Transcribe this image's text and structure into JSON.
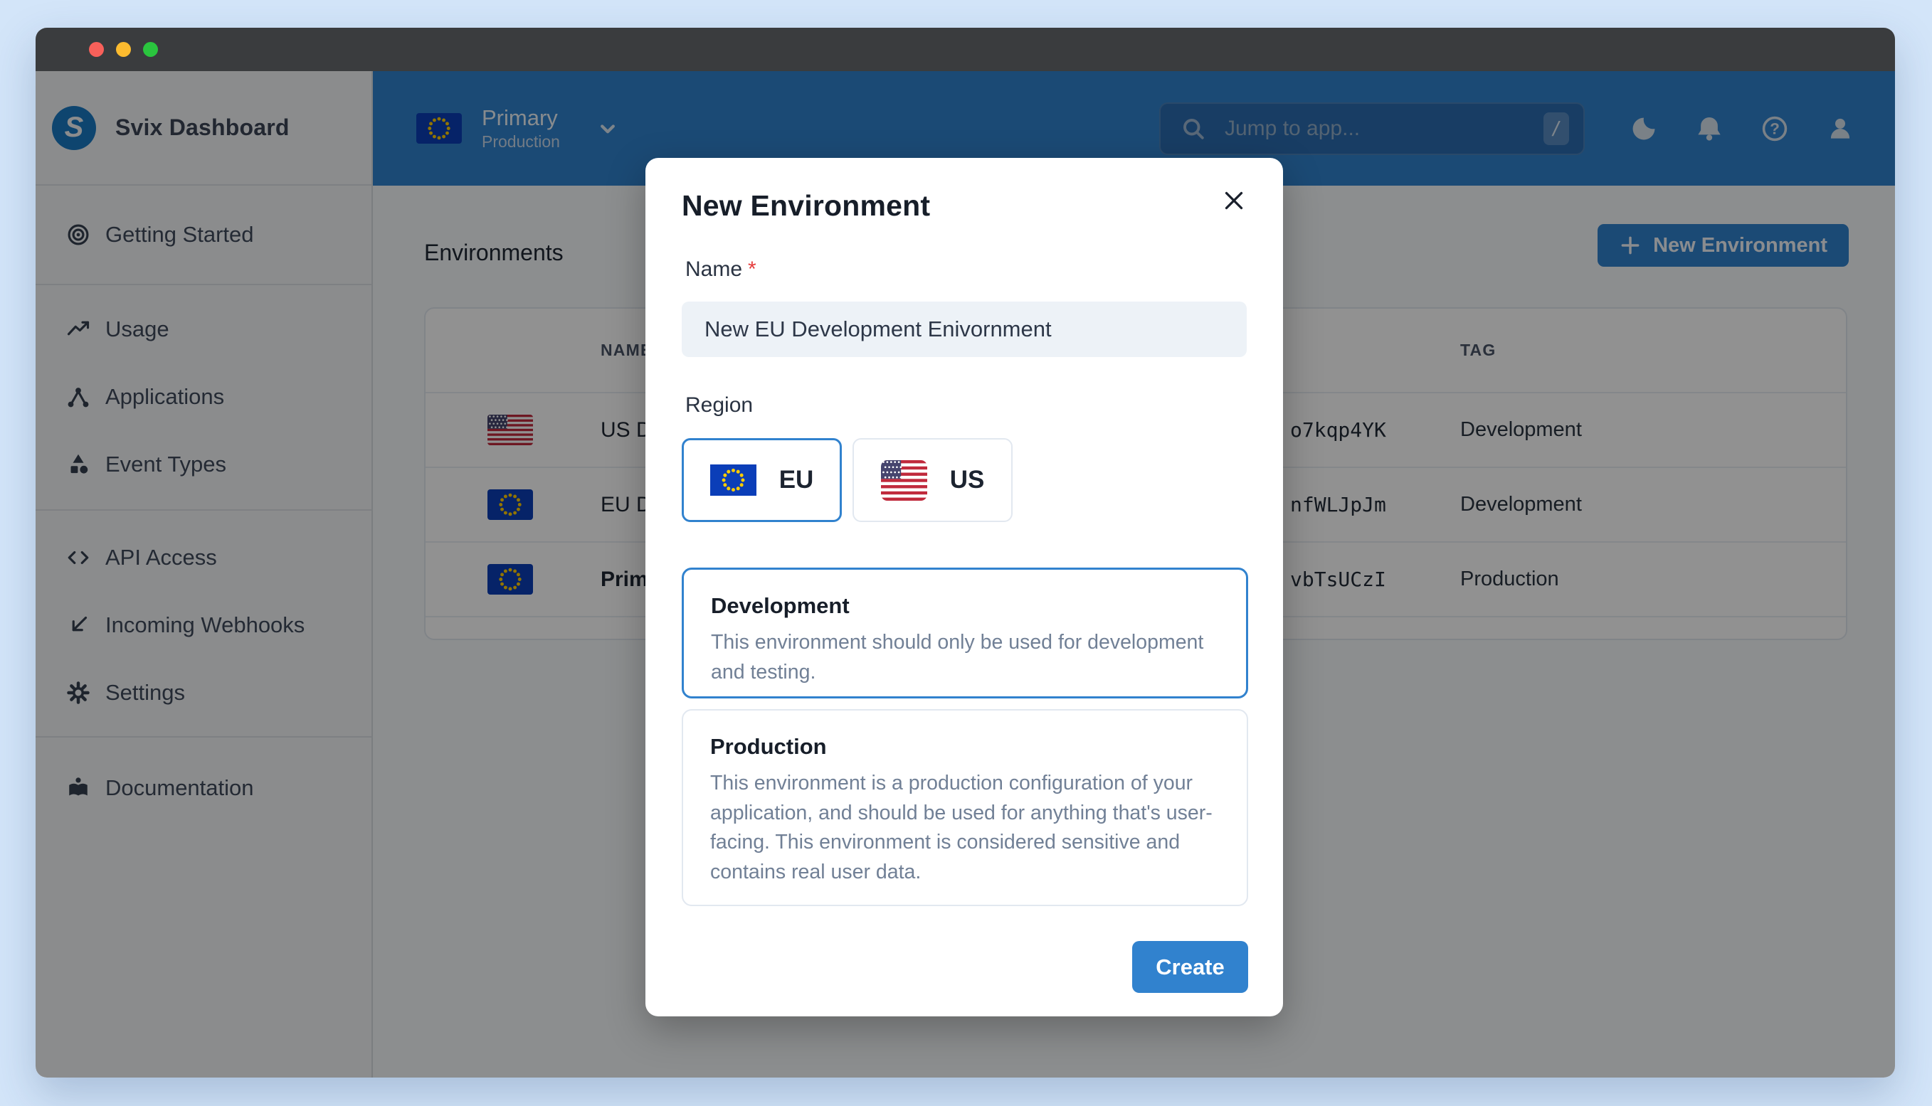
{
  "colors": {
    "accent": "#3182ce",
    "topbar": "#3182ce",
    "overlay": "rgba(0,0,0,0.43)",
    "required": "#e53e3e"
  },
  "sidebar": {
    "app_title": "Svix Dashboard",
    "logo_letter": "S",
    "items": [
      {
        "label": "Getting Started",
        "icon": "target-icon"
      },
      {
        "label": "Usage",
        "icon": "trend-icon"
      },
      {
        "label": "Applications",
        "icon": "network-icon"
      },
      {
        "label": "Event Types",
        "icon": "shapes-icon"
      },
      {
        "label": "API Access",
        "icon": "code-icon"
      },
      {
        "label": "Incoming Webhooks",
        "icon": "arrow-down-left-icon"
      },
      {
        "label": "Settings",
        "icon": "gear-icon"
      },
      {
        "label": "Documentation",
        "icon": "book-icon"
      }
    ]
  },
  "topbar": {
    "env_name": "Primary",
    "env_tag": "Production",
    "env_flag": "eu",
    "search_placeholder": "Jump to app...",
    "search_shortcut": "/",
    "icons": {
      "help_glyph": "?"
    }
  },
  "page": {
    "heading": "Environments",
    "new_env_button": "New Environment"
  },
  "table": {
    "columns": [
      "NAME",
      "TAG"
    ],
    "rows": [
      {
        "flag": "us",
        "name": "US D",
        "id": "o7kqp4YK",
        "tag": "Development"
      },
      {
        "flag": "eu",
        "name": "EU D",
        "id": "nfWLJpJm",
        "tag": "Development"
      },
      {
        "flag": "eu",
        "name": "Prim",
        "id": "vbTsUCzI",
        "tag": "Production"
      }
    ]
  },
  "modal": {
    "title": "New Environment",
    "name_label": "Name",
    "required_mark": "*",
    "name_value": "New EU Development Enivornment",
    "region_label": "Region",
    "regions": [
      {
        "code": "EU",
        "flag": "eu",
        "selected": true
      },
      {
        "code": "US",
        "flag": "us",
        "selected": false
      }
    ],
    "env_types": [
      {
        "title": "Development",
        "desc": "This environment should only be used for development and testing.",
        "selected": true
      },
      {
        "title": "Production",
        "desc": "This environment is a production configuration of your application, and should be used for anything that's user-facing. This environment is considered sensitive and contains real user data.",
        "selected": false
      }
    ],
    "create_label": "Create"
  }
}
